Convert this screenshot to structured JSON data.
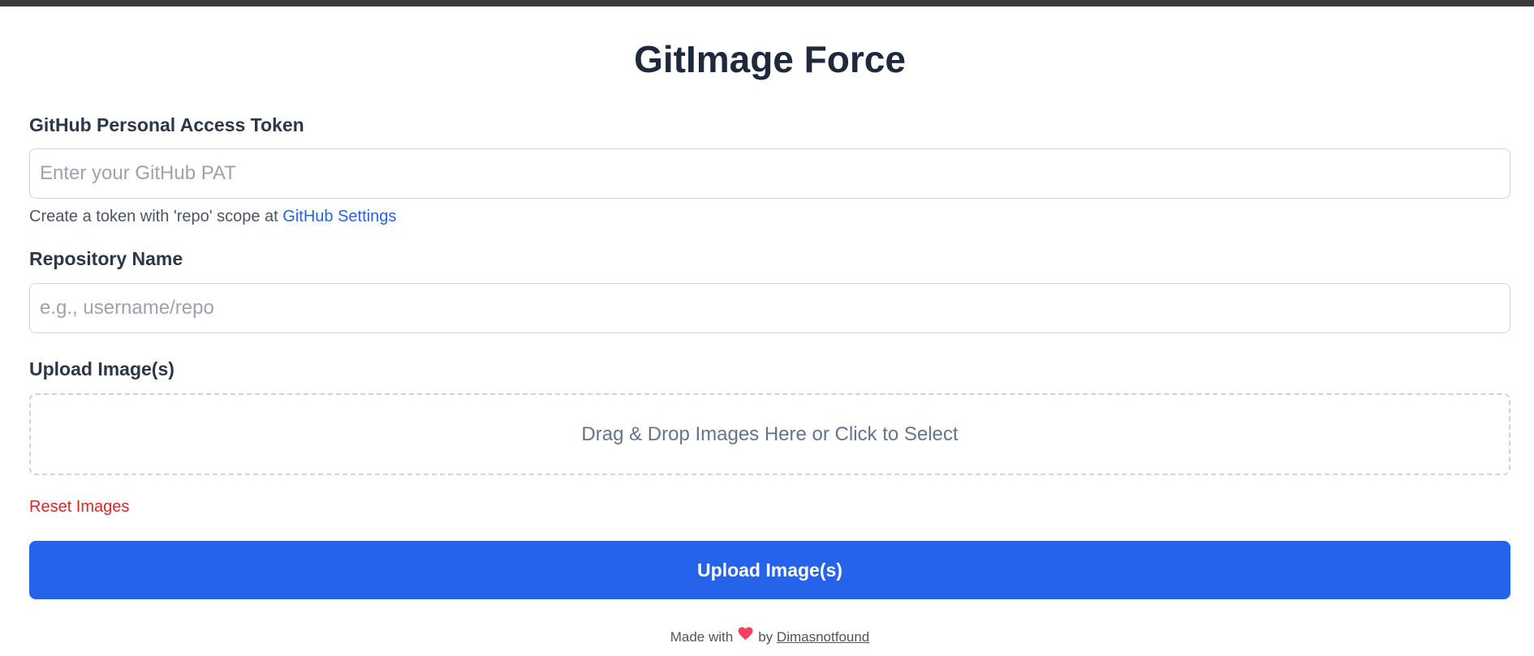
{
  "app": {
    "title": "GitImage Force"
  },
  "form": {
    "token": {
      "label": "GitHub Personal Access Token",
      "placeholder": "Enter your GitHub PAT",
      "value": "",
      "hint_prefix": "Create a token with 'repo' scope at ",
      "hint_link": "GitHub Settings"
    },
    "repo": {
      "label": "Repository Name",
      "placeholder": "e.g., username/repo",
      "value": ""
    },
    "upload": {
      "label": "Upload Image(s)",
      "dropzone_text": "Drag & Drop Images Here or Click to Select",
      "reset_label": "Reset Images",
      "button_label": "Upload Image(s)"
    }
  },
  "footer": {
    "made_with": "Made with",
    "heart_icon": "heart-icon",
    "by": "by",
    "author": "Dimasnotfound"
  },
  "colors": {
    "primary": "#2563eb",
    "danger": "#dc2626",
    "heart": "#f43f5e",
    "title": "#1e293b"
  }
}
